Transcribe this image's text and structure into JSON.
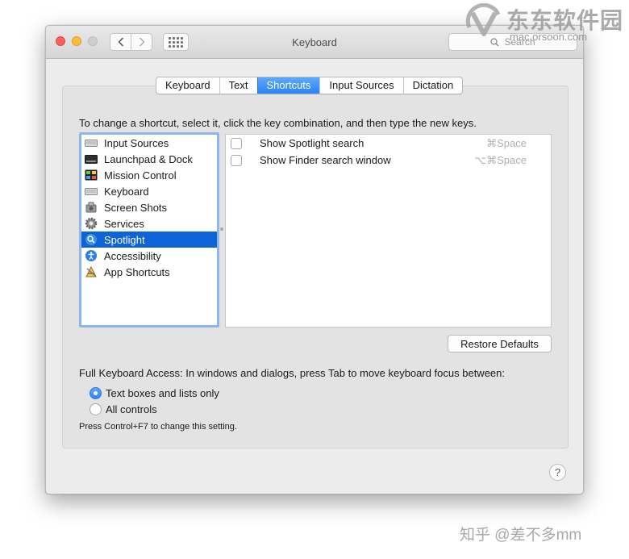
{
  "window": {
    "title": "Keyboard"
  },
  "toolbar": {
    "back_icon": "chevron-left-icon",
    "forward_icon": "chevron-right-icon",
    "grid_icon": "grid-icon",
    "search_placeholder": "Search"
  },
  "tabs": [
    {
      "label": "Keyboard",
      "active": false
    },
    {
      "label": "Text",
      "active": false
    },
    {
      "label": "Shortcuts",
      "active": true
    },
    {
      "label": "Input Sources",
      "active": false
    },
    {
      "label": "Dictation",
      "active": false
    }
  ],
  "instruction": "To change a shortcut, select it, click the key combination, and then type the new keys.",
  "categories": [
    {
      "label": "Input Sources",
      "icon": "keyboard-icon"
    },
    {
      "label": "Launchpad & Dock",
      "icon": "dock-icon"
    },
    {
      "label": "Mission Control",
      "icon": "mission-control-icon"
    },
    {
      "label": "Keyboard",
      "icon": "keyboard-icon"
    },
    {
      "label": "Screen Shots",
      "icon": "screenshot-icon"
    },
    {
      "label": "Services",
      "icon": "gear-icon"
    },
    {
      "label": "Spotlight",
      "icon": "spotlight-icon",
      "selected": true
    },
    {
      "label": "Accessibility",
      "icon": "accessibility-icon"
    },
    {
      "label": "App Shortcuts",
      "icon": "app-shortcuts-icon"
    }
  ],
  "shortcuts": [
    {
      "label": "Show Spotlight search",
      "key": "⌘Space",
      "checked": false
    },
    {
      "label": "Show Finder search window",
      "key": "⌥⌘Space",
      "checked": false
    }
  ],
  "restore_button": "Restore Defaults",
  "full_keyboard_access": {
    "label": "Full Keyboard Access: In windows and dialogs, press Tab to move keyboard focus between:",
    "options": [
      {
        "label": "Text boxes and lists only",
        "selected": true
      },
      {
        "label": "All controls",
        "selected": false
      }
    ],
    "hint": "Press Control+F7 to change this setting."
  },
  "help_button": "?",
  "watermarks": {
    "top_title": "东东软件园",
    "top_url": "mac.orsoon.com",
    "bottom": "知乎 @差不多mm"
  },
  "colors": {
    "accent": "#2a83f6",
    "selection": "#0e63d8",
    "close": "#fc605c",
    "minimize": "#fdbc40"
  }
}
